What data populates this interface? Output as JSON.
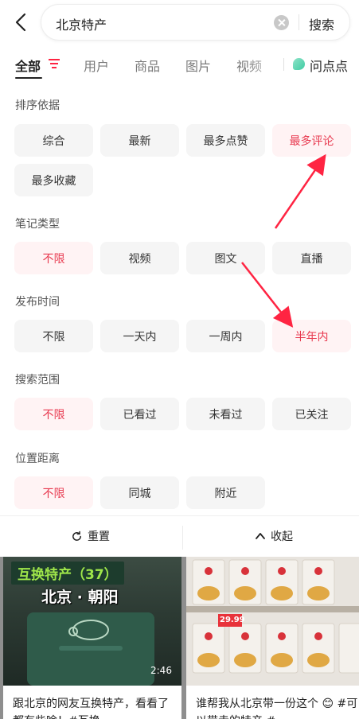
{
  "search": {
    "query": "北京特产",
    "button": "搜索"
  },
  "tabs": [
    {
      "label": "全部",
      "active": true
    },
    {
      "label": "用户"
    },
    {
      "label": "商品"
    },
    {
      "label": "图片"
    },
    {
      "label": "视频"
    },
    {
      "label": "问点点"
    }
  ],
  "filters": {
    "sort": {
      "title": "排序依据",
      "options": [
        "综合",
        "最新",
        "最多点赞",
        "最多评论",
        "最多收藏"
      ],
      "selected": "最多评论"
    },
    "note_type": {
      "title": "笔记类型",
      "options": [
        "不限",
        "视频",
        "图文",
        "直播"
      ],
      "selected": "不限"
    },
    "publish_time": {
      "title": "发布时间",
      "options": [
        "不限",
        "一天内",
        "一周内",
        "半年内"
      ],
      "selected": "半年内"
    },
    "search_scope": {
      "title": "搜索范围",
      "options": [
        "不限",
        "已看过",
        "未看过",
        "已关注"
      ],
      "selected": "不限"
    },
    "distance": {
      "title": "位置距离",
      "options": [
        "不限",
        "同城",
        "附近"
      ],
      "selected": "不限"
    }
  },
  "actions": {
    "reset": "重置",
    "collapse": "收起"
  },
  "feed": [
    {
      "badge": "互换特产（37）",
      "location": "北京 · 朝阳",
      "duration": "2:46",
      "title": "跟北京的网友互换特产，看看了都有些啥！#互换..."
    },
    {
      "price": "29.99",
      "title": "谁帮我从北京带一份这个 😊 #可以带走的特产 #..."
    }
  ],
  "colors": {
    "accent": "#ff2442",
    "chip_selected_bg": "#fff3f4",
    "chip_selected_text": "#e8394f",
    "chip_bg": "#f5f5f5"
  },
  "icons": {
    "back": "chevron-left-icon",
    "clear": "clear-icon",
    "filter": "filter-icon",
    "reset": "refresh-icon",
    "collapse": "chevron-up-icon"
  }
}
